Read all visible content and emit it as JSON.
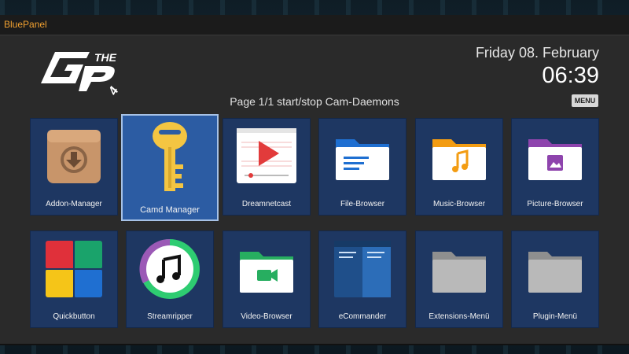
{
  "window": {
    "title": "BluePanel"
  },
  "header": {
    "date": "Friday 08. February",
    "time": "06:39",
    "subtitle": "Page 1/1 start/stop Cam-Daemons",
    "menu_button": "MENU",
    "logo_text": "THE GP4"
  },
  "colors": {
    "tile_bg": "#1e3762",
    "tile_selected_bg": "#2c5ca3",
    "title_accent": "#f0a030"
  },
  "tiles": [
    {
      "label": "Addon-Manager",
      "icon": "package-icon"
    },
    {
      "label": "Camd Manager",
      "icon": "key-icon",
      "selected": true
    },
    {
      "label": "Dreamnetcast",
      "icon": "play-video-icon"
    },
    {
      "label": "File-Browser",
      "icon": "folder-document-icon"
    },
    {
      "label": "Music-Browser",
      "icon": "folder-music-icon"
    },
    {
      "label": "Picture-Browser",
      "icon": "folder-image-icon"
    },
    {
      "label": "Quickbutton",
      "icon": "quad-grid-icon"
    },
    {
      "label": "Streamripper",
      "icon": "music-note-icon"
    },
    {
      "label": "Video-Browser",
      "icon": "folder-video-icon"
    },
    {
      "label": "eCommander",
      "icon": "dual-pane-icon"
    },
    {
      "label": "Extensions-Menü",
      "icon": "folder-grey-icon"
    },
    {
      "label": "Plugin-Menü",
      "icon": "folder-grey-icon"
    }
  ]
}
